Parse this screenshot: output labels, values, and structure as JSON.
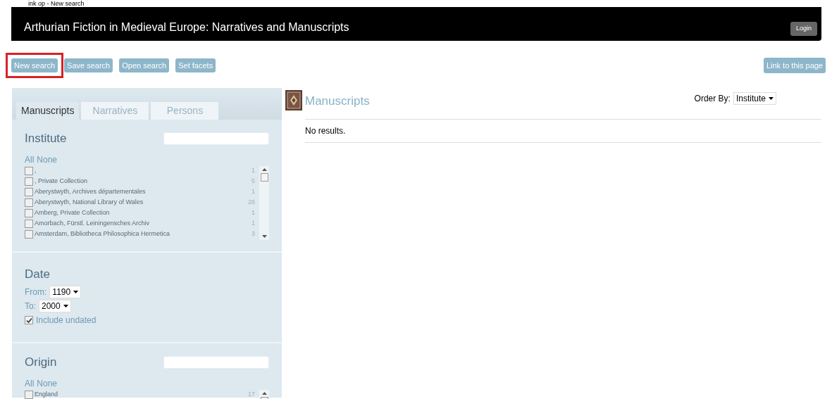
{
  "caption": "ink op - New search",
  "header": {
    "title": "Arthurian Fiction in Medieval Europe: Narratives and Manuscripts",
    "login": "Login"
  },
  "toolbar": {
    "buttons": [
      {
        "label": "New search",
        "highlighted": true
      },
      {
        "label": "Save search",
        "highlighted": false
      },
      {
        "label": "Open search",
        "highlighted": false
      },
      {
        "label": "Set facets",
        "highlighted": false
      }
    ],
    "link": "Link to this page"
  },
  "tabs": [
    {
      "label": "Manuscripts",
      "selected": true
    },
    {
      "label": "Narratives",
      "selected": false
    },
    {
      "label": "Persons",
      "selected": false
    }
  ],
  "facets": [
    {
      "kind": "list",
      "title": "Institute",
      "all": "All",
      "none": "None",
      "items": [
        {
          "label": ",",
          "count": "1",
          "checked": false
        },
        {
          "label": ", Private Collection",
          "count": "5",
          "checked": false
        },
        {
          "label": "Aberystwyth, Archives départementales",
          "count": "1",
          "checked": false
        },
        {
          "label": "Aberystwyth, National Library of Wales",
          "count": "26",
          "checked": false
        },
        {
          "label": "Amberg, Private Collection",
          "count": "1",
          "checked": false
        },
        {
          "label": "Amorbach, Fürstl. Leiningensches Archiv",
          "count": "1",
          "checked": false
        },
        {
          "label": "Amsterdam, Bibliotheca Philosophica Hermetica",
          "count": "3",
          "checked": false
        }
      ]
    },
    {
      "kind": "date",
      "title": "Date",
      "from_label": "From:",
      "from": "1190",
      "to_label": "To:",
      "to": "2000",
      "undated": {
        "label": "Include undated",
        "checked": true
      }
    },
    {
      "kind": "list",
      "title": "Origin",
      "all": "All",
      "none": "None",
      "items": [
        {
          "label": "England",
          "count": "17",
          "checked": false
        }
      ]
    }
  ],
  "results": {
    "title": "Manuscripts",
    "order_label": "Order By:",
    "order": "Institute",
    "message": "No results."
  }
}
